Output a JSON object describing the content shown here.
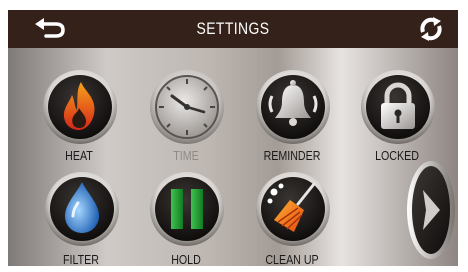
{
  "header": {
    "title": "SETTINGS",
    "back_icon": "back-arrow-icon",
    "sync_icon": "sync-icon"
  },
  "tiles": [
    {
      "label": "HEAT",
      "icon": "flame-icon",
      "enabled": true
    },
    {
      "label": "TIME",
      "icon": "clock-icon",
      "enabled": false
    },
    {
      "label": "REMINDER",
      "icon": "bell-icon",
      "enabled": true
    },
    {
      "label": "LOCKED",
      "icon": "padlock-icon",
      "enabled": true
    },
    {
      "label": "FILTER",
      "icon": "water-drop-icon",
      "enabled": true
    },
    {
      "label": "HOLD",
      "icon": "pause-icon",
      "enabled": true
    },
    {
      "label": "CLEAN UP",
      "icon": "broom-icon",
      "enabled": true
    }
  ],
  "next_icon": "chevron-right-icon",
  "colors": {
    "header_bg": "#34211a",
    "panel_gradient": [
      "#7f7a77",
      "#cfcac7",
      "#a39b95",
      "#e7e3e1"
    ],
    "flame": "#e8501a",
    "drop": "#3b86d6",
    "pause": "#1f9d31",
    "broom": "#f07a14"
  }
}
